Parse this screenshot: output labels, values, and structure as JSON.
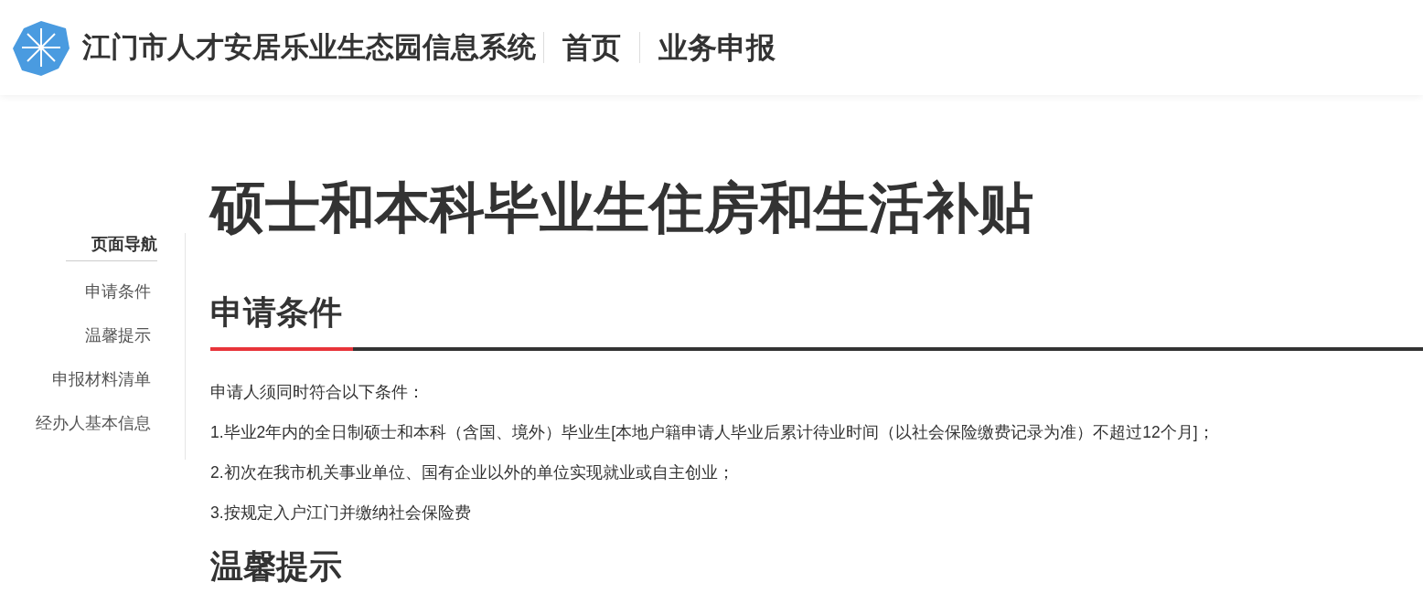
{
  "header": {
    "title": "江门市人才安居乐业生态园信息系统",
    "nav_links": [
      {
        "label": "首页"
      },
      {
        "label": "业务申报"
      }
    ]
  },
  "page_title": "硕士和本科毕业生住房和生活补贴",
  "sidebar": {
    "title": "页面导航",
    "items": [
      {
        "label": "申请条件"
      },
      {
        "label": "温馨提示"
      },
      {
        "label": "申报材料清单"
      },
      {
        "label": "经办人基本信息"
      }
    ]
  },
  "sections": [
    {
      "heading": "申请条件",
      "paragraphs": [
        "申请人须同时符合以下条件：",
        "1.毕业2年内的全日制硕士和本科（含国、境外）毕业生[本地户籍申请人毕业后累计待业时间（以社会保险缴费记录为准）不超过12个月]；",
        "2.初次在我市机关事业单位、国有企业以外的单位实现就业或自主创业；",
        "3.按规定入户江门并缴纳社会保险费"
      ]
    },
    {
      "heading": "温馨提示"
    }
  ]
}
